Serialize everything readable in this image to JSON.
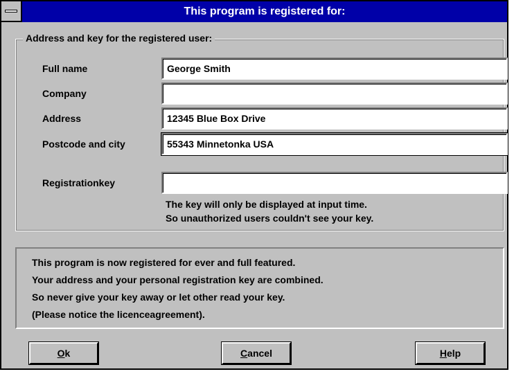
{
  "window": {
    "title": "This program is registered for:"
  },
  "registration_group": {
    "legend": "Address and key for the registered user:",
    "full_name_label": "Full name",
    "full_name_value": "George Smith",
    "company_label": "Company",
    "company_value": "",
    "address_label": "Address",
    "address_value": "12345 Blue Box Drive",
    "postcode_label": "Postcode and city",
    "postcode_value": "55343 Minnetonka USA",
    "key_label": "Registrationkey",
    "key_value": "",
    "hint_line1": "The key will only be displayed at input time.",
    "hint_line2": "So unauthorized users couldn't see your key."
  },
  "info": {
    "lines": [
      "This program is now registered for ever and full featured.",
      "Your address and your personal registration key are combined.",
      "So never give your key away or let other read your key.",
      "(Please notice the licenceagreement)."
    ]
  },
  "buttons": {
    "ok_mnemonic": "O",
    "ok_rest": "k",
    "cancel_mnemonic": "C",
    "cancel_rest": "ancel",
    "help_mnemonic": "H",
    "help_rest": "elp"
  }
}
